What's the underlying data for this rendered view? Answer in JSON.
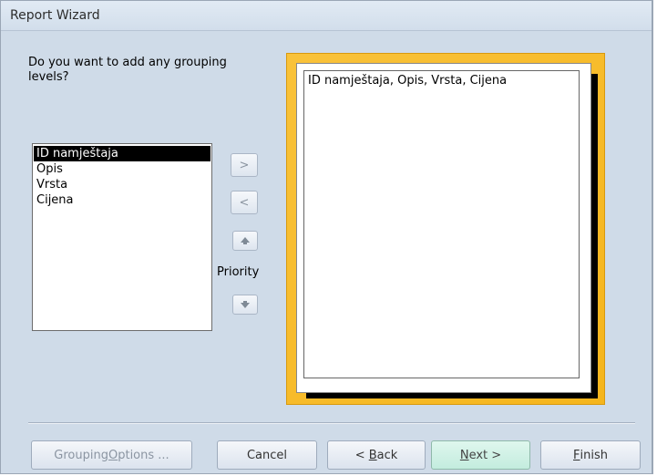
{
  "window": {
    "title": "Report Wizard"
  },
  "question": "Do you want to add any grouping levels?",
  "fields": [
    {
      "label": "ID namještaja",
      "selected": true
    },
    {
      "label": "Opis",
      "selected": false
    },
    {
      "label": "Vrsta",
      "selected": false
    },
    {
      "label": "Cijena",
      "selected": false
    }
  ],
  "side_buttons": {
    "add": ">",
    "remove": "<",
    "priority": "Priority"
  },
  "preview": {
    "text": "ID namještaja, Opis, Vrsta, Cijena"
  },
  "buttons": {
    "grouping_options": {
      "prefix": "Grouping ",
      "mnemonic": "O",
      "suffix": "ptions ..."
    },
    "cancel": "Cancel",
    "back": {
      "prefix": "< ",
      "mnemonic": "B",
      "suffix": "ack"
    },
    "next": {
      "prefix": "",
      "mnemonic": "N",
      "suffix": "ext >"
    },
    "finish": {
      "prefix": "",
      "mnemonic": "F",
      "suffix": "inish"
    }
  },
  "colors": {
    "window_bg": "#cfdbe8",
    "preview_frame": "#f5b51c",
    "next_bg": "#c3ecde"
  }
}
